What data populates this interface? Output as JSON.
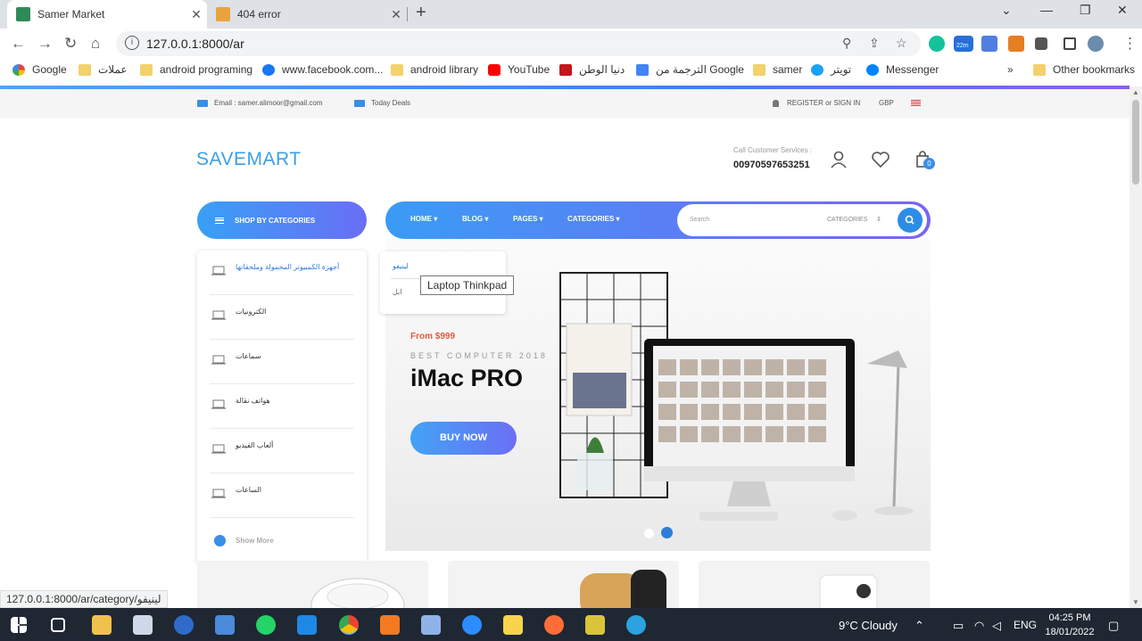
{
  "browser": {
    "tabs": [
      {
        "title": "Samer Market",
        "active": true
      },
      {
        "title": "404 error",
        "active": false
      }
    ],
    "url": "127.0.0.1:8000/ar",
    "extension_badge": "22m",
    "bookmarks": [
      "Google",
      "عملات",
      "android programing",
      "www.facebook.com...",
      "android library",
      "YouTube",
      "دنيا الوطن",
      "Google الترجمة من",
      "samer",
      "تويتر",
      "Messenger"
    ],
    "other_bookmarks": "Other bookmarks",
    "status_url": "127.0.0.1:8000/ar/category/لينيفو"
  },
  "topbar": {
    "email": "Email : samer.alimoor@gmail.com",
    "deals": "Today Deals",
    "register": "REGISTER",
    "or": "or",
    "signin": "SIGN IN",
    "currency": "GBP"
  },
  "header": {
    "logo": "SAVEMART",
    "cs_label": "Call Customer Services :",
    "cs_phone": "00970597653251",
    "cart_count": "0"
  },
  "nav": {
    "shop_by": "SHOP BY CATEGORIES",
    "items": [
      "HOME",
      "BLOG",
      "PAGES",
      "CATEGORIES"
    ],
    "search_placeholder": "Search",
    "search_category": "CATEGORIES"
  },
  "categories": [
    "أجهزة الكمبيوتر المحمولة وملحقاتها",
    "الكترونيات",
    "سماعات",
    "هواتف نقالة",
    "ألعاب الفيديو",
    "الساعات"
  ],
  "show_more": "Show More",
  "submenu": {
    "item1": "لينيفو",
    "item2": "ابل"
  },
  "tooltip": "Laptop Thinkpad",
  "banner": {
    "from": "From $999",
    "subtitle": "BEST COMPUTER 2018",
    "title": "iMac PRO",
    "cta": "BUY NOW"
  },
  "taskbar": {
    "weather": "9°C  Cloudy",
    "lang": "ENG",
    "time": "04:25 PM",
    "date": "18/01/2022"
  },
  "colors": {
    "accent": "#3a8ee6",
    "logo": "#3aa0e8",
    "price": "#e9573f"
  }
}
